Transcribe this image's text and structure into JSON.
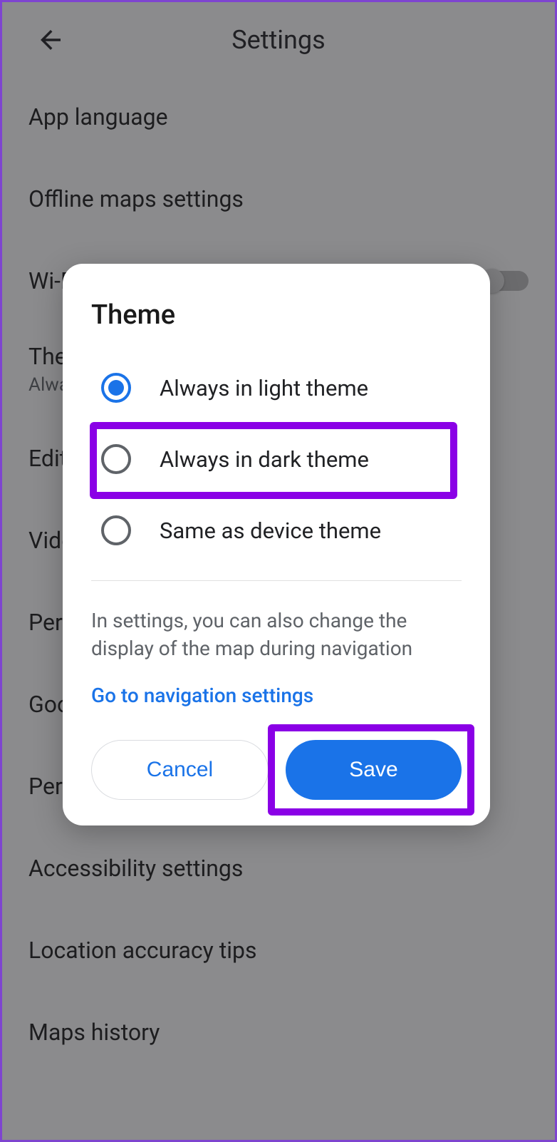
{
  "header": {
    "title": "Settings"
  },
  "rows": {
    "app_language": "App language",
    "offline": "Offline maps settings",
    "wifi": "Wi-Fi only",
    "theme_title": "Theme",
    "theme_sub": "Always in light theme",
    "edit": "Edit home or work",
    "video": "Video settings",
    "pin": "Personal content",
    "google": "Google Assistant settings",
    "personal": "Personal content",
    "accessibility": "Accessibility settings",
    "location": "Location accuracy tips",
    "history": "Maps history"
  },
  "dialog": {
    "title": "Theme",
    "options": {
      "light": "Always in light theme",
      "dark": "Always in dark theme",
      "device": "Same as device theme"
    },
    "message": "In settings, you can also change the display of the map during navigation",
    "link": "Go to navigation settings",
    "cancel": "Cancel",
    "save": "Save"
  }
}
